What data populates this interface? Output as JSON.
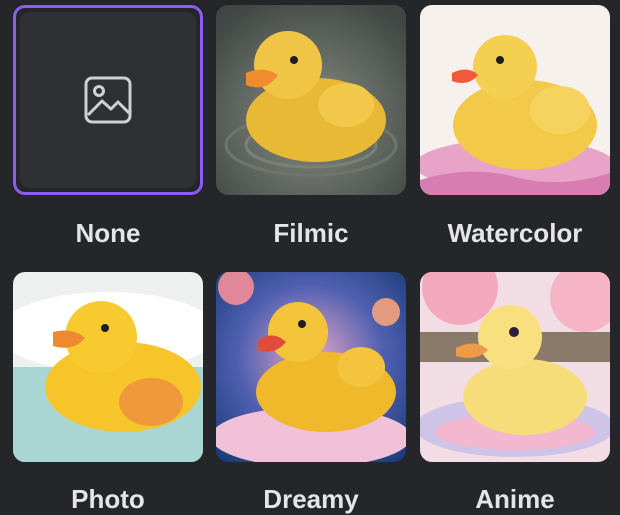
{
  "styles": [
    {
      "label": "None",
      "selected": true
    },
    {
      "label": "Filmic",
      "selected": false
    },
    {
      "label": "Watercolor",
      "selected": false
    },
    {
      "label": "Photo",
      "selected": false
    },
    {
      "label": "Dreamy",
      "selected": false
    },
    {
      "label": "Anime",
      "selected": false
    }
  ],
  "icons": {
    "none_tile": "image-placeholder-icon"
  },
  "colors": {
    "accent": "#8b5cf6",
    "background": "#242629",
    "tile": "#2f3033",
    "text": "#e5e5e7"
  }
}
